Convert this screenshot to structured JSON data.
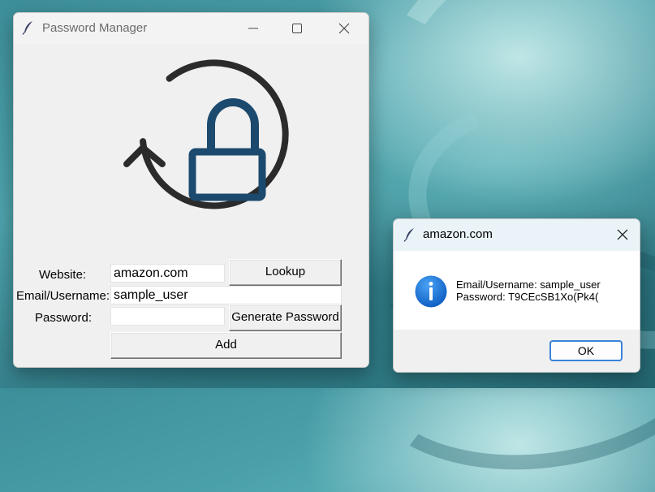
{
  "main_window": {
    "title": "Password Manager",
    "icon": "feather-icon",
    "logo_icon": "lock-refresh-icon",
    "form": {
      "website_label": "Website:",
      "website_value": "amazon.com",
      "email_label": "Email/Username:",
      "email_value": "sample_user",
      "password_label": "Password:",
      "password_value": "",
      "lookup_button": "Lookup",
      "generate_button": "Generate Password",
      "add_button": "Add"
    }
  },
  "dialog": {
    "title": "amazon.com",
    "icon": "info-icon",
    "line1": "Email/Username: sample_user",
    "line2": "Password: T9CEcSB1Xo(Pk4(",
    "ok_button": "OK"
  },
  "colors": {
    "lock": "#1c4a6e",
    "arrow": "#2b2b2b",
    "info": "#1a73d9",
    "focus": "#3a83d8"
  }
}
